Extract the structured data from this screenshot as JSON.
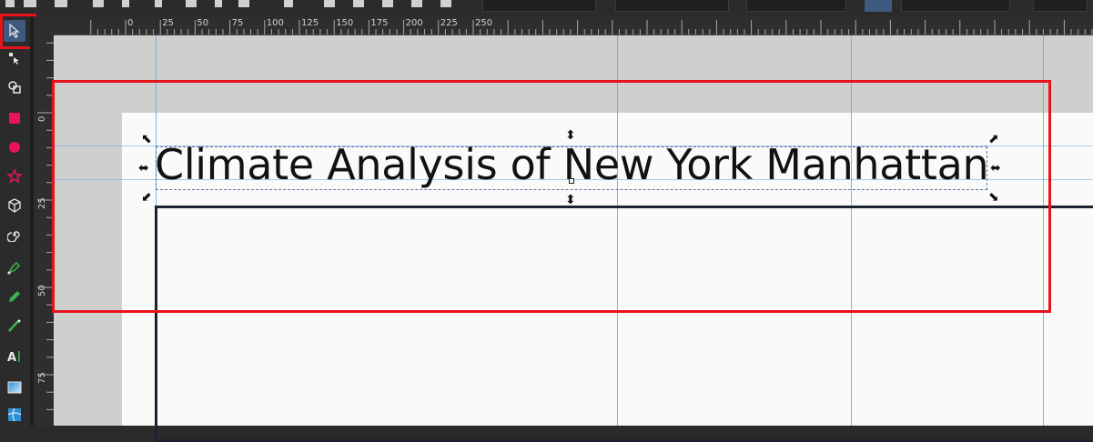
{
  "document": {
    "title_text": "Climate Analysis of New York Manhattan"
  },
  "toolbox": {
    "tools": [
      {
        "name": "select-tool",
        "icon": "pointer-arrow-icon",
        "active": true
      },
      {
        "name": "node-tool",
        "icon": "node-edit-icon"
      },
      {
        "name": "shape-builder-tool",
        "icon": "shape-builder-icon"
      },
      {
        "name": "rectangle-tool",
        "icon": "rectangle-icon",
        "color": "#e8145a"
      },
      {
        "name": "circle-tool",
        "icon": "circle-icon",
        "color": "#e8145a"
      },
      {
        "name": "star-tool",
        "icon": "star-icon",
        "color": "#e8145a"
      },
      {
        "name": "3d-box-tool",
        "icon": "cube-icon"
      },
      {
        "name": "spiral-tool",
        "icon": "spiral-icon"
      },
      {
        "name": "pen-tool",
        "icon": "pen-icon",
        "color": "#3cb44b"
      },
      {
        "name": "pencil-tool",
        "icon": "pencil-icon",
        "color": "#3cb44b"
      },
      {
        "name": "calligraphy-tool",
        "icon": "calligraphy-icon",
        "color": "#3cb44b"
      },
      {
        "name": "text-tool",
        "icon": "text-icon"
      },
      {
        "name": "gradient-tool",
        "icon": "gradient-icon",
        "color": "#2b8fd6"
      },
      {
        "name": "mesh-tool",
        "icon": "mesh-icon",
        "color": "#2b8fd6"
      }
    ]
  },
  "rulers": {
    "horizontal_labels": [
      "0",
      "25",
      "50",
      "75",
      "100",
      "125",
      "150",
      "175",
      "200",
      "225",
      "250"
    ],
    "vertical_labels": [
      "0",
      "25",
      "50",
      "75"
    ]
  },
  "colors": {
    "highlight": "#e8141c",
    "guide": "#6aa6e0",
    "active_tool_bg": "#3d5a80"
  }
}
